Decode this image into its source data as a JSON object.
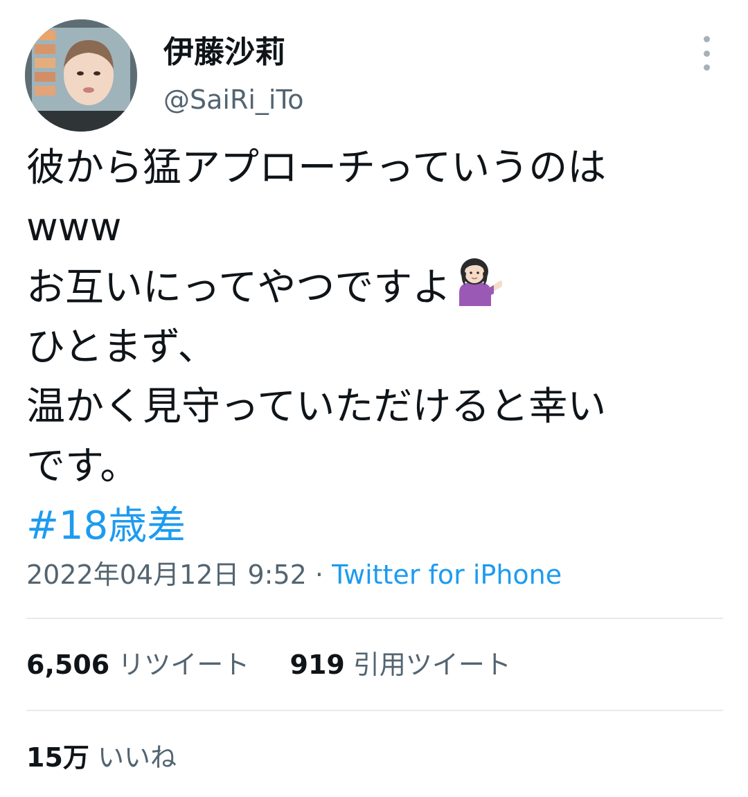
{
  "tweet": {
    "author": {
      "display_name": "伊藤沙莉",
      "username": "@SaiRi_iTo"
    },
    "text_lines": [
      "彼から猛アプローチっていうのは",
      "www",
      "お互いにってやつですよ",
      "ひとまず、",
      "温かく見守っていただけると幸い",
      "です。"
    ],
    "emoji": "person-tipping-hand",
    "hashtag": "#18歳差",
    "timestamp": "2022年04月12日 9:52",
    "separator": " · ",
    "source": "Twitter for iPhone"
  },
  "stats": {
    "retweets_count": "6,506",
    "retweets_label": "リツイート",
    "quotes_count": "919",
    "quotes_label": "引用ツイート",
    "likes_count": "15万",
    "likes_label": "いいね"
  },
  "colors": {
    "link": "#1d9bf0",
    "secondary_text": "#536471",
    "primary_text": "#0f1419",
    "divider": "#e7eaec"
  }
}
